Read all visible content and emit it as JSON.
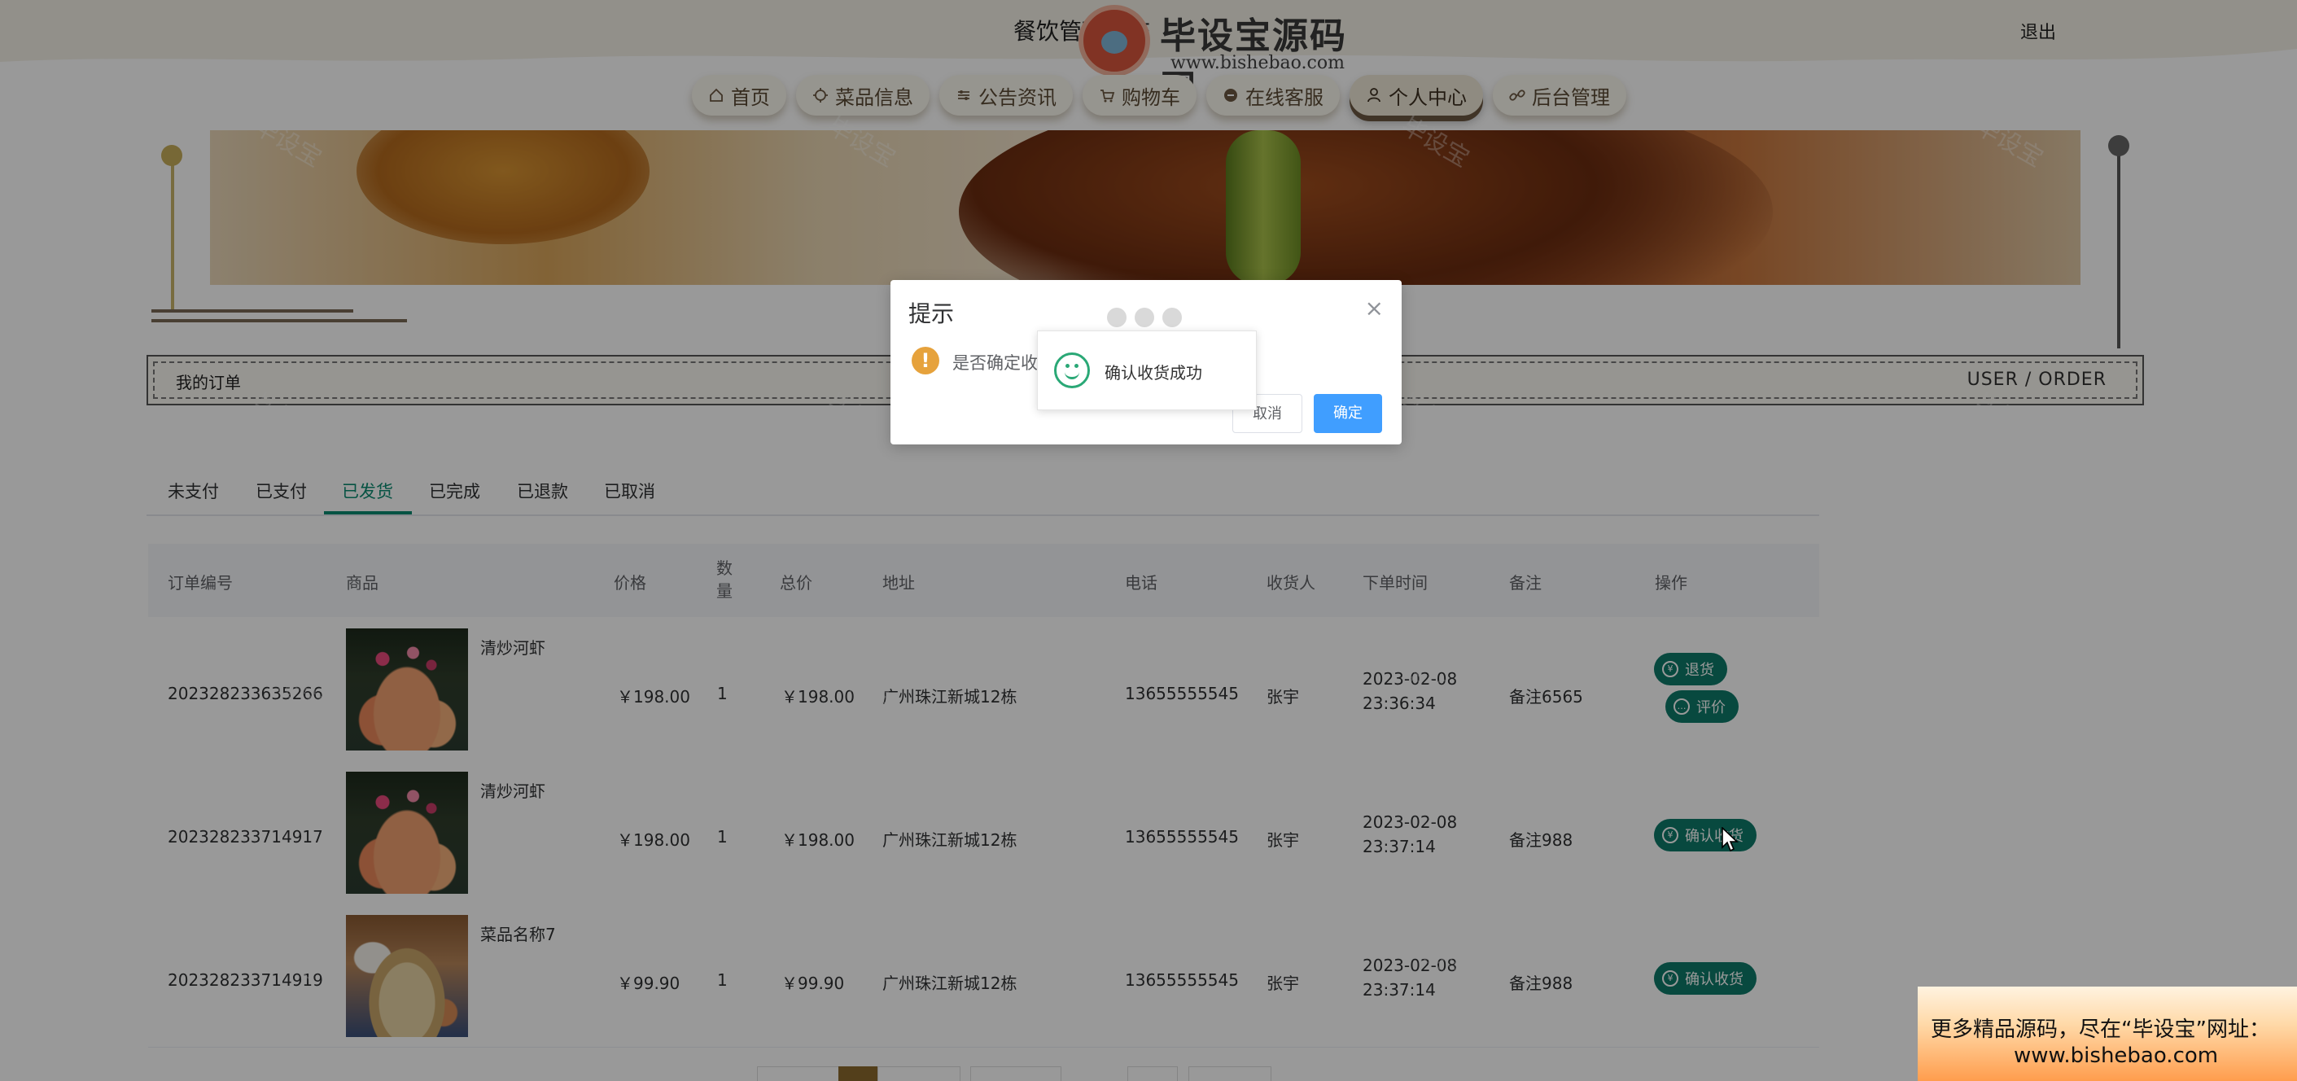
{
  "header": {
    "site_title": "餐饮管理系统",
    "logout": "退出",
    "watermark_title": "毕设宝源码网",
    "watermark_url": "www.bishebao.com"
  },
  "nav": [
    {
      "label": "首页",
      "icon": "home-icon"
    },
    {
      "label": "菜品信息",
      "icon": "dish-icon"
    },
    {
      "label": "公告资讯",
      "icon": "news-icon"
    },
    {
      "label": "购物车",
      "icon": "cart-icon"
    },
    {
      "label": "在线客服",
      "icon": "chat-icon"
    },
    {
      "label": "个人中心",
      "icon": "user-icon",
      "active": true
    },
    {
      "label": "后台管理",
      "icon": "link-icon"
    }
  ],
  "section": {
    "left": "我的订单",
    "right": "USER / ORDER"
  },
  "tabs": [
    "未支付",
    "已支付",
    "已发货",
    "已完成",
    "已退款",
    "已取消"
  ],
  "active_tab": 2,
  "table": {
    "headers": [
      "订单编号",
      "商品",
      "价格",
      "数量",
      "总价",
      "地址",
      "电话",
      "收货人",
      "下单时间",
      "备注",
      "操作"
    ],
    "rows": [
      {
        "order_no": "202328233635266",
        "product": "清炒河虾",
        "price": "￥198.00",
        "qty": "1",
        "total": "￥198.00",
        "address": "广州珠江新城12栋",
        "phone": "13655555545",
        "receiver": "张宇",
        "date": "2023-02-08",
        "time": "23:36:34",
        "note": "备注6565",
        "actions": [
          "退货",
          "评价"
        ]
      },
      {
        "order_no": "202328233714917",
        "product": "清炒河虾",
        "price": "￥198.00",
        "qty": "1",
        "total": "￥198.00",
        "address": "广州珠江新城12栋",
        "phone": "13655555545",
        "receiver": "张宇",
        "date": "2023-02-08",
        "time": "23:37:14",
        "note": "备注988",
        "actions": [
          "确认收货"
        ]
      },
      {
        "order_no": "202328233714919",
        "product": "菜品名称7",
        "price": "￥99.90",
        "qty": "1",
        "total": "￥99.90",
        "address": "广州珠江新城12栋",
        "phone": "13655555545",
        "receiver": "张宇",
        "date": "2023-02-08",
        "time": "23:37:14",
        "note": "备注988",
        "actions": [
          "确认收货"
        ]
      }
    ]
  },
  "dialog": {
    "title": "提示",
    "close": "×",
    "message": "是否确定收",
    "cancel": "取消",
    "ok": "确定"
  },
  "toast": {
    "message": "确认收货成功"
  },
  "ad": {
    "line1": "更多精品源码，尽在“毕设宝”网址：",
    "line2": "www.bishebao.com"
  },
  "watermark_text": "毕设宝",
  "colors": {
    "accent": "#0e7a6a",
    "tab_active": "#0b8a70",
    "dialog_ok": "#409eff",
    "warn": "#e6a23c"
  }
}
